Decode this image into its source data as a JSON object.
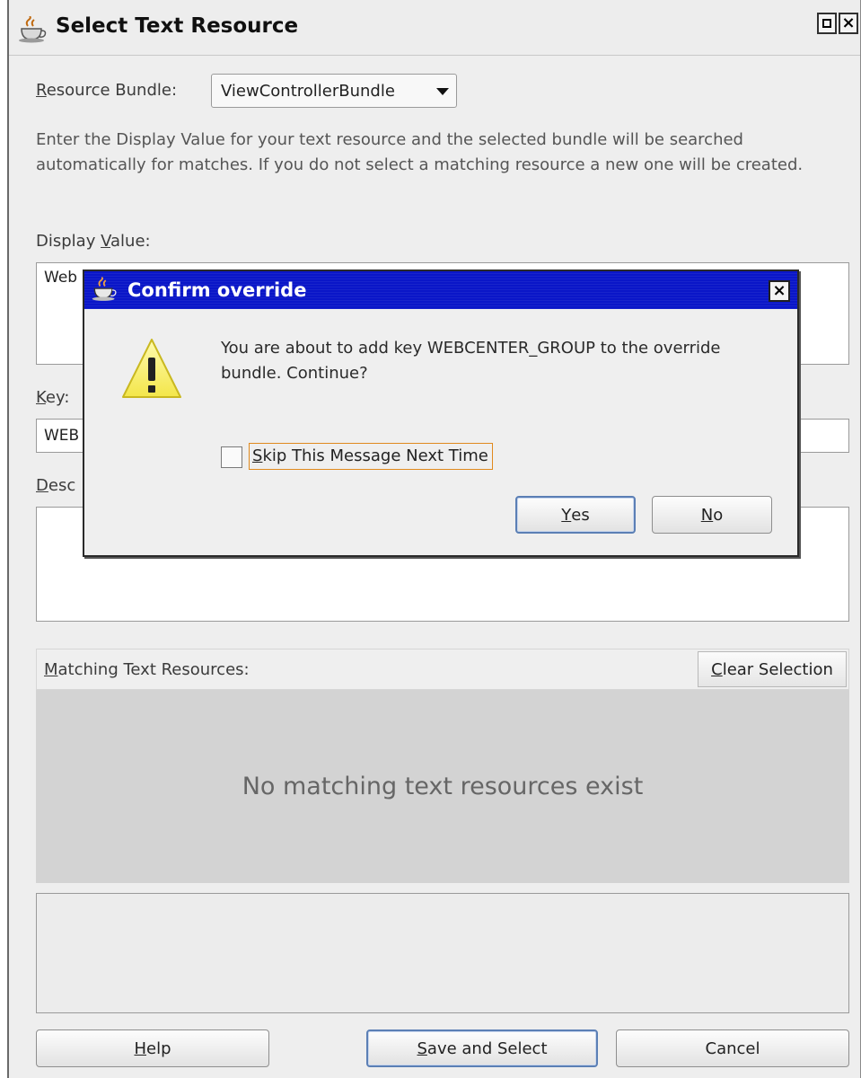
{
  "window": {
    "title": "Select Text Resource",
    "maximize_icon": "maximize-icon",
    "close_icon": "close-icon"
  },
  "resource_bundle": {
    "label": "esource Bundle:",
    "label_mnemonic": "R",
    "value": "ViewControllerBundle"
  },
  "instructions": "Enter the Display Value for your text resource and the selected bundle will be searched automatically for matches.  If you do not select a matching resource a new one will be created.",
  "display_value": {
    "label_pre": "Display ",
    "label_mnemonic": "V",
    "label_post": "alue:",
    "value": "Web"
  },
  "key": {
    "label_mnemonic": "K",
    "label_post": "ey:",
    "value": "WEB"
  },
  "description": {
    "label_mnemonic": "D",
    "label_post": "esc",
    "value": ""
  },
  "matching": {
    "label_mnemonic": "M",
    "label_post": "atching Text Resources:",
    "clear_mnemonic": "C",
    "clear_post": "lear Selection",
    "empty_message": "No matching text resources exist"
  },
  "buttons": {
    "help_mnemonic": "H",
    "help_post": "elp",
    "save_mnemonic": "S",
    "save_post": "ave and Select",
    "cancel": "Cancel"
  },
  "confirm": {
    "title": "Confirm override",
    "message": "You are about to add key WEBCENTER_GROUP to the override bundle.  Continue?",
    "checkbox_mnemonic": "S",
    "checkbox_post": "kip This Message Next Time",
    "checkbox_checked": false,
    "yes_mnemonic": "Y",
    "yes_post": "es",
    "no_mnemonic": "N",
    "no_post": "o",
    "icon": "warning-icon"
  },
  "colors": {
    "confirm_title_bar": "#0a16c8",
    "focus_outline": "#e08a1e",
    "default_button_border": "#5b7fb5"
  }
}
